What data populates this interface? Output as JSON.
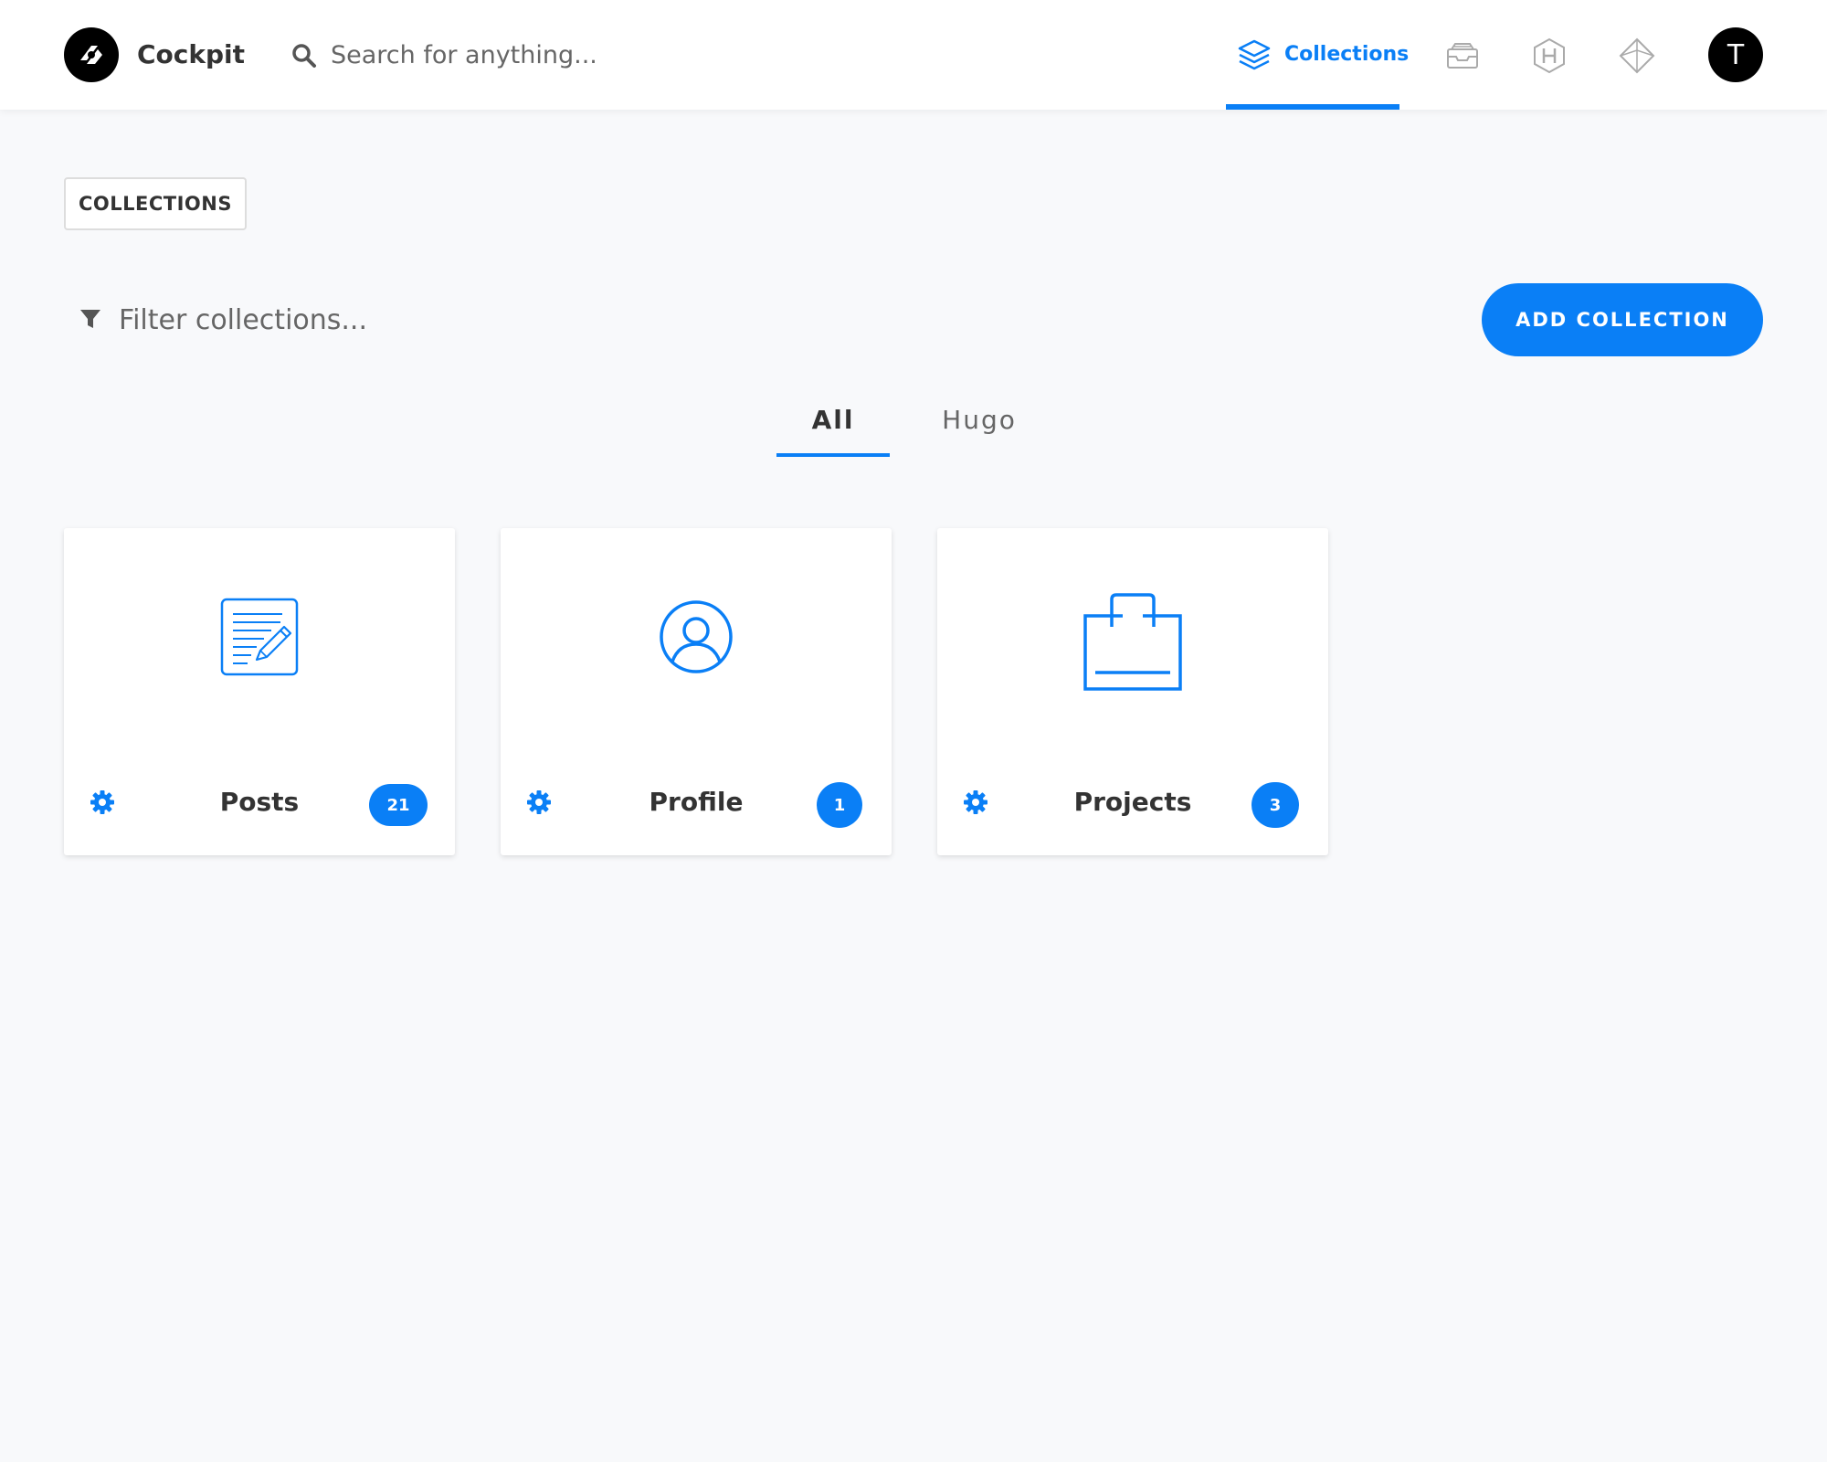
{
  "app": {
    "name": "Cockpit"
  },
  "search": {
    "placeholder": "Search for anything..."
  },
  "nav": {
    "active_label": "Collections",
    "icons": [
      "layers-icon",
      "inbox-icon",
      "hugo-icon",
      "diamond-icon"
    ]
  },
  "user": {
    "avatar_initial": "T"
  },
  "breadcrumb": {
    "label": "COLLECTIONS"
  },
  "filter": {
    "placeholder": "Filter collections..."
  },
  "actions": {
    "add_label": "ADD COLLECTION"
  },
  "tabs": [
    {
      "label": "All",
      "active": true
    },
    {
      "label": "Hugo",
      "active": false
    }
  ],
  "collections": [
    {
      "title": "Posts",
      "count": "21",
      "icon": "document-edit-icon"
    },
    {
      "title": "Profile",
      "count": "1",
      "icon": "user-circle-icon"
    },
    {
      "title": "Projects",
      "count": "3",
      "icon": "bag-icon"
    }
  ],
  "colors": {
    "accent": "#0a7ff6",
    "background": "#f8f9fb",
    "text": "#333333"
  }
}
